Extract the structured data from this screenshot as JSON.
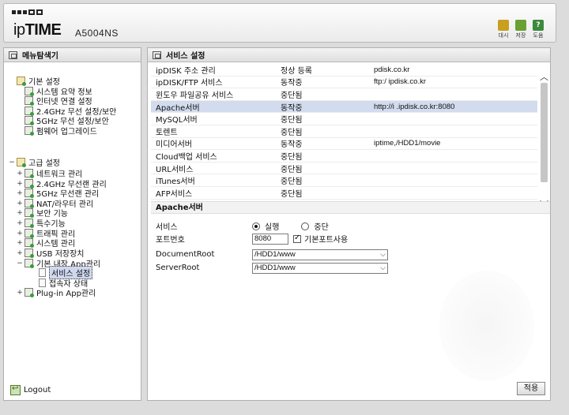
{
  "header": {
    "logo_prefix": "ip",
    "logo_bold": "TIME",
    "model": "A5004NS",
    "tools": [
      {
        "label": "대시",
        "icon": "dashboard-icon",
        "color": "#c8a020"
      },
      {
        "label": "저장",
        "icon": "save-icon",
        "color": "#6aa030"
      },
      {
        "label": "도움",
        "icon": "help-icon",
        "color": "#3c8a3c"
      }
    ]
  },
  "left": {
    "title": "메뉴탐색기",
    "tree": [
      {
        "label": "기본 설정",
        "toggle": "",
        "level": 0,
        "icon": "folder"
      },
      {
        "label": "시스템 요약 정보",
        "toggle": "",
        "level": 1,
        "icon": "item"
      },
      {
        "label": "인터넷 연결 설정",
        "toggle": "",
        "level": 1,
        "icon": "item"
      },
      {
        "label": "2.4GHz 무선 설정/보안",
        "toggle": "",
        "level": 1,
        "icon": "item"
      },
      {
        "label": "5GHz 무선 설정/보안",
        "toggle": "",
        "level": 1,
        "icon": "item"
      },
      {
        "label": "펌웨어 업그레이드",
        "toggle": "",
        "level": 1,
        "icon": "item"
      },
      {
        "label": "고급 설정",
        "toggle": "−",
        "level": 0,
        "icon": "folder"
      },
      {
        "label": "네트워크 관리",
        "toggle": "+",
        "level": 1,
        "icon": "item"
      },
      {
        "label": "2.4GHz 무선랜 관리",
        "toggle": "+",
        "level": 1,
        "icon": "item"
      },
      {
        "label": "5GHz 무선랜 관리",
        "toggle": "+",
        "level": 1,
        "icon": "item"
      },
      {
        "label": "NAT/라우터 관리",
        "toggle": "+",
        "level": 1,
        "icon": "item"
      },
      {
        "label": "보안 기능",
        "toggle": "+",
        "level": 1,
        "icon": "item"
      },
      {
        "label": "특수기능",
        "toggle": "+",
        "level": 1,
        "icon": "item"
      },
      {
        "label": "트래픽 관리",
        "toggle": "+",
        "level": 1,
        "icon": "item"
      },
      {
        "label": "시스템 관리",
        "toggle": "+",
        "level": 1,
        "icon": "item"
      },
      {
        "label": "USB 저장장치",
        "toggle": "+",
        "level": 1,
        "icon": "item"
      },
      {
        "label": "기본 내장 App관리",
        "toggle": "−",
        "level": 1,
        "icon": "item"
      },
      {
        "label": "서비스 설정",
        "toggle": "",
        "level": 2,
        "icon": "doc",
        "selected": true
      },
      {
        "label": "접속자 상태",
        "toggle": "",
        "level": 2,
        "icon": "doc"
      },
      {
        "label": "Plug-in App관리",
        "toggle": "+",
        "level": 1,
        "icon": "item"
      }
    ],
    "logout": "Logout"
  },
  "right": {
    "title": "서비스 설정",
    "services": [
      {
        "name": "ipDISK 주소 관리",
        "status": "정상 등록",
        "info": "pdisk.co.kr"
      },
      {
        "name": "ipDISK/FTP 서비스",
        "status": "동작중",
        "info": "ftp:/ ipdisk.co.kr"
      },
      {
        "name": "윈도우 파일공유 서비스",
        "status": "중단됨",
        "info": ""
      },
      {
        "name": "Apache서버",
        "status": "동작중",
        "info": "http://i .ipdisk.co.kr:8080",
        "selected": true
      },
      {
        "name": "MySQL서버",
        "status": "중단됨",
        "info": ""
      },
      {
        "name": "토렌트",
        "status": "중단됨",
        "info": ""
      },
      {
        "name": "미디어서버",
        "status": "동작중",
        "info": "iptime,/HDD1/movie"
      },
      {
        "name": "Cloud백업 서비스",
        "status": "중단됨",
        "info": ""
      },
      {
        "name": "URL서비스",
        "status": "중단됨",
        "info": ""
      },
      {
        "name": "iTunes서버",
        "status": "중단됨",
        "info": ""
      },
      {
        "name": "AFP서비스",
        "status": "중단됨",
        "info": ""
      }
    ],
    "section_title": "Apache서버",
    "form": {
      "service_label": "서비스",
      "run_label": "실행",
      "stop_label": "중단",
      "port_label": "포트번호",
      "port_value": "8080",
      "default_port_label": "기본포트사용",
      "docroot_label": "DocumentRoot",
      "docroot_value": "/HDD1/www",
      "serverroot_label": "ServerRoot",
      "serverroot_value": "/HDD1/www"
    },
    "apply_label": "적용"
  }
}
